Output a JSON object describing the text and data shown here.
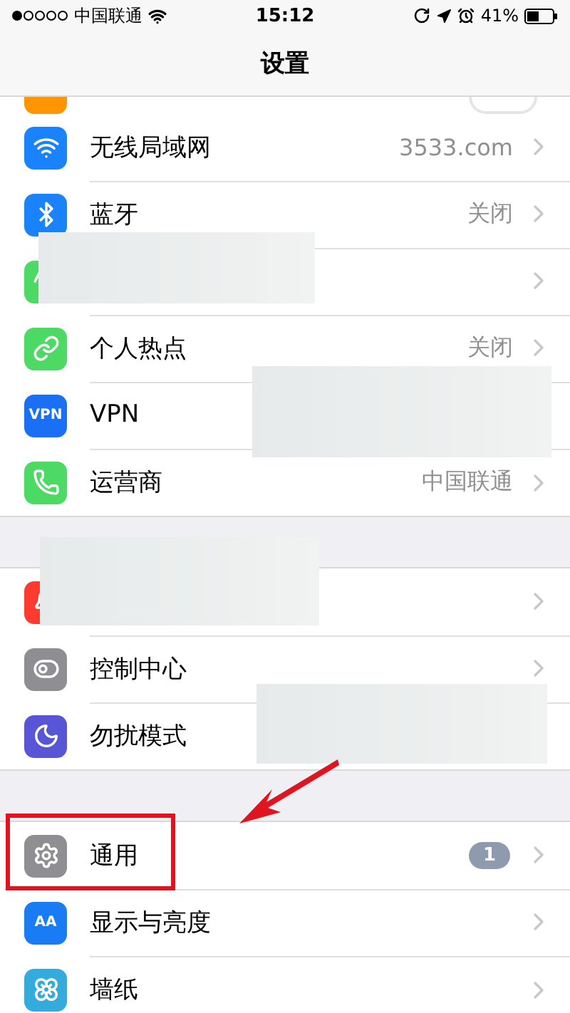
{
  "status_bar": {
    "carrier": "中国联通",
    "time": "15:12",
    "battery": "41%"
  },
  "nav_bar": {
    "title": "设置"
  },
  "top_partial_row": {
    "on": false
  },
  "groups": [
    {
      "rows": [
        {
          "color": "#1a82fb",
          "label": "无线局域网",
          "value": "3533.com"
        },
        {
          "color": "#1a82fb",
          "label": "蓝牙",
          "value": "关闭"
        },
        {
          "color": "#4cd964"
        },
        {
          "color": "#4cd964",
          "label": "个人热点",
          "value": "关闭"
        },
        {
          "color": "#1a6ff5",
          "icon_text": "VPN",
          "label": "VPN"
        },
        {
          "color": "#4cd964",
          "label": "运营商",
          "value": "中国联通"
        }
      ]
    },
    {
      "rows": [
        {
          "color": "#ff3b30"
        },
        {
          "color": "#8e8e93",
          "label": "控制中心"
        },
        {
          "color": "#5856d6",
          "label": "勿扰模式"
        }
      ]
    },
    {
      "rows": [
        {
          "color": "#8e8e93",
          "label": "通用",
          "badge": "1"
        },
        {
          "color": "#1a7cf5",
          "icon_text": "AA",
          "label": "显示与亮度"
        },
        {
          "color": "#35aadc",
          "label": "墙纸"
        }
      ]
    }
  ]
}
